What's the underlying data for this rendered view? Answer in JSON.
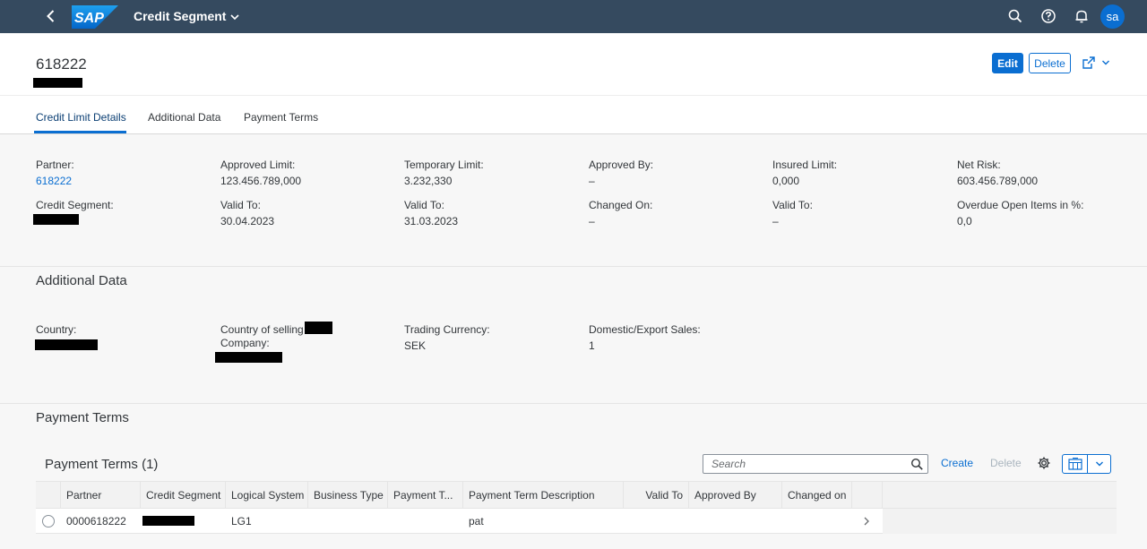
{
  "shell": {
    "app_title": "Credit Segment",
    "logo_text": "SAP",
    "avatar_initials": "sa"
  },
  "header": {
    "object_title": "618222",
    "edit_label": "Edit",
    "delete_label": "Delete",
    "tabs": [
      {
        "label": "Credit Limit Details"
      },
      {
        "label": "Additional Data"
      },
      {
        "label": "Payment Terms"
      }
    ]
  },
  "credit_limit": {
    "partner_label": "Partner:",
    "partner_value": "618222",
    "credit_segment_label": "Credit Segment:",
    "approved_limit_label": "Approved Limit:",
    "approved_limit_value": "123.456.789,000",
    "valid_to_1_label": "Valid To:",
    "valid_to_1_value": "30.04.2023",
    "temporary_limit_label": "Temporary Limit:",
    "temporary_limit_value": "3.232,330",
    "valid_to_2_label": "Valid To:",
    "valid_to_2_value": "31.03.2023",
    "approved_by_label": "Approved By:",
    "approved_by_value": "–",
    "changed_on_label": "Changed On:",
    "changed_on_value": "–",
    "insured_limit_label": "Insured Limit:",
    "insured_limit_value": "0,000",
    "valid_to_3_label": "Valid To:",
    "valid_to_3_value": "–",
    "net_risk_label": "Net Risk:",
    "net_risk_value": "603.456.789,000",
    "overdue_label": "Overdue Open Items in %:",
    "overdue_value": "0,0"
  },
  "additional_data": {
    "title": "Additional Data",
    "country_label": "Country:",
    "country_selling_label_1": "Country of selling",
    "country_selling_label_2": "Company:",
    "trading_currency_label": "Trading Currency:",
    "trading_currency_value": "SEK",
    "domestic_export_label": "Domestic/Export Sales:",
    "domestic_export_value": "1"
  },
  "payment_terms": {
    "section_title": "Payment Terms",
    "table_title": "Payment Terms (1)",
    "search_placeholder": "Search",
    "create_label": "Create",
    "delete_label": "Delete",
    "columns": [
      "Partner",
      "Credit Segment",
      "Logical System",
      "Business Type",
      "Payment T...",
      "Payment Term Description",
      "Valid To",
      "Approved By",
      "Changed on"
    ],
    "rows": [
      {
        "partner": "0000618222",
        "credit_segment": "",
        "logical_system": "LG1",
        "business_type": "",
        "payment_term": "",
        "description": "pat",
        "valid_to": "",
        "approved_by": "",
        "changed_on": ""
      }
    ]
  },
  "icons": {
    "back": "chevron-left-icon",
    "title_dropdown": "chevron-down-icon",
    "search": "search-icon",
    "help": "help-icon",
    "notifications": "bell-icon",
    "share": "share-icon",
    "settings": "gear-icon",
    "export": "export-excel-icon",
    "row_nav": "chevron-right-icon"
  },
  "colors": {
    "shell_bg": "#354a5f",
    "accent": "#0a6ed1",
    "avatar_bg": "#0a6ed1"
  }
}
